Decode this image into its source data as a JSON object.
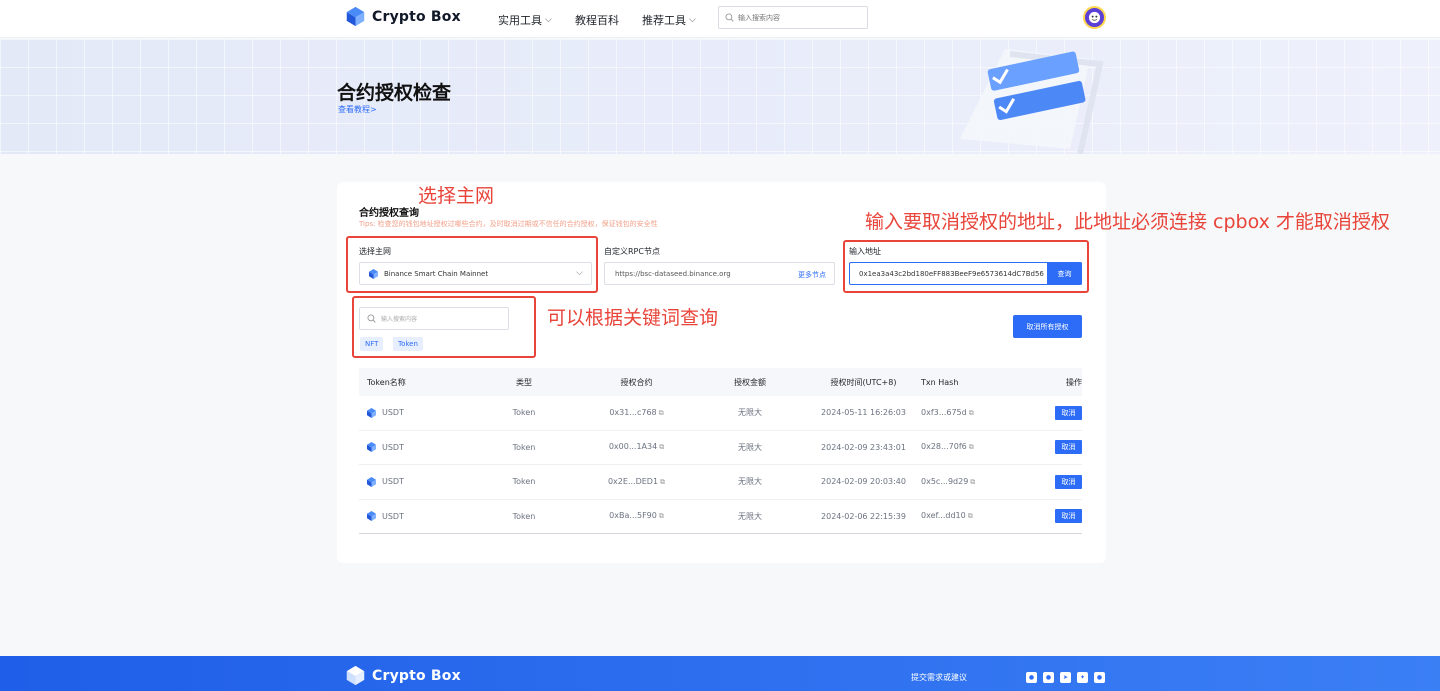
{
  "header": {
    "brand": "Crypto Box",
    "nav": [
      {
        "label": "实用工具"
      },
      {
        "label": "教程百科"
      },
      {
        "label": "推荐工具"
      }
    ],
    "search_placeholder": "输入搜索内容"
  },
  "hero": {
    "title": "合约授权检查",
    "tutorial_link": "查看教程>"
  },
  "card": {
    "title": "合约授权查询",
    "tips": "Tips: 检查您的钱包地址授权过哪些合约，及时取消过期或不信任的合约授权，保证钱包的安全性",
    "network_label": "选择主网",
    "network_value": "Binance Smart Chain Mainnet",
    "rpc_label": "自定义RPC节点",
    "rpc_value": "https://bsc-dataseed.binance.org",
    "rpc_more": "更多节点",
    "address_label": "输入地址",
    "address_value": "0x1ea3a43c2bd180eFF883BeeF9e6573614dC7Bd56",
    "query_button": "查询",
    "keyword_placeholder": "输入搜索内容",
    "tags": [
      "NFT",
      "Token"
    ],
    "revoke_all_button": "取消所有授权"
  },
  "table": {
    "headers": [
      "Token名称",
      "类型",
      "授权合约",
      "授权金额",
      "授权时间(UTC+8)",
      "Txn Hash",
      "操作"
    ],
    "rows": [
      {
        "token": "USDT",
        "type": "Token",
        "contract": "0x31...c768",
        "amount": "无限大",
        "time": "2024-05-11 16:26:03",
        "hash": "0xf3...675d",
        "action": "取消"
      },
      {
        "token": "USDT",
        "type": "Token",
        "contract": "0x00...1A34",
        "amount": "无限大",
        "time": "2024-02-09 23:43:01",
        "hash": "0x28...70f6",
        "action": "取消"
      },
      {
        "token": "USDT",
        "type": "Token",
        "contract": "0x2E...DED1",
        "amount": "无限大",
        "time": "2024-02-09 20:03:40",
        "hash": "0x5c...9d29",
        "action": "取消"
      },
      {
        "token": "USDT",
        "type": "Token",
        "contract": "0xBa...5F90",
        "amount": "无限大",
        "time": "2024-02-06 22:15:39",
        "hash": "0xef...dd10",
        "action": "取消"
      }
    ]
  },
  "annotations": {
    "network": "选择主网",
    "address": "输入要取消授权的地址，此地址必须连接 cpbox 才能取消授权",
    "keyword": "可以根据关键词查询",
    "color": "#e8443a"
  },
  "footer": {
    "brand": "Crypto Box",
    "feedback_link": "提交需求或建议",
    "social_icons": [
      "wechat-icon",
      "weibo-icon",
      "telegram-icon",
      "twitter-icon",
      "discord-icon"
    ]
  },
  "colors": {
    "accent": "#2d6cf6",
    "annotation": "#e8443a"
  }
}
